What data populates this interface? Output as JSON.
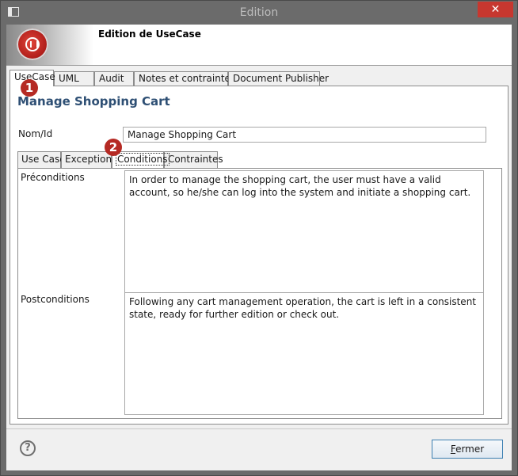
{
  "window": {
    "title": "Edition",
    "close_glyph": "✕",
    "icon": "app-window-icon"
  },
  "header": {
    "title": "Edition de UseCase",
    "logo": "project-logo-icon"
  },
  "top_tabs": [
    {
      "label": "UseCase",
      "active": true
    },
    {
      "label": "UML",
      "active": false
    },
    {
      "label": "Audit",
      "active": false
    },
    {
      "label": "Notes et contraintes",
      "active": false
    },
    {
      "label": "Document Publisher",
      "active": false
    }
  ],
  "badges": [
    "1",
    "2"
  ],
  "usecase": {
    "section_title": "Manage Shopping Cart",
    "name_label": "Nom/Id",
    "name_value": "Manage Shopping Cart"
  },
  "inner_tabs": [
    {
      "label": "Use Case",
      "active": false
    },
    {
      "label": "Exceptions",
      "active": false
    },
    {
      "label": "Conditions",
      "active": true
    },
    {
      "label": "Contraintes",
      "active": false
    }
  ],
  "conditions": {
    "preconditions_label": "Préconditions",
    "preconditions_text": "In order to manage the shopping cart, the user must have a valid account, so he/she can log into the system and initiate a shopping cart.",
    "postconditions_label": "Postconditions",
    "postconditions_text": "Following any cart management operation, the cart is left in a consistent state, ready for further edition or check out."
  },
  "footer": {
    "help_glyph": "?",
    "close_button_mnemonic": "F",
    "close_button_rest": "ermer"
  },
  "colors": {
    "title_blue": "#2e4f74",
    "badge_red": "#b52a24",
    "close_red": "#c7372f"
  }
}
